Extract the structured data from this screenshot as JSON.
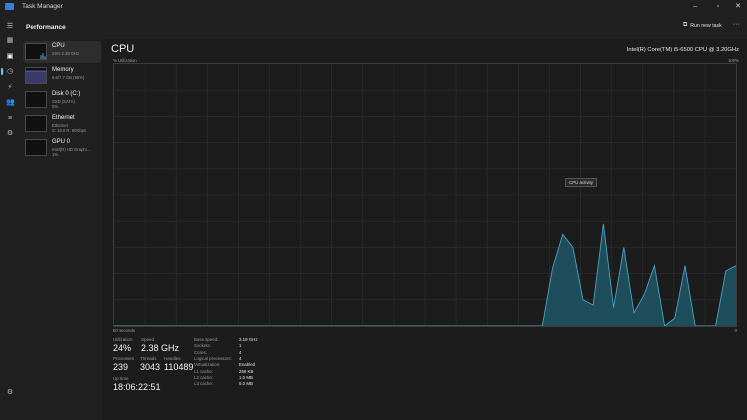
{
  "app": {
    "title": "Task Manager",
    "page_heading": "Performance",
    "run_new_task": "Run new task",
    "more": "···"
  },
  "sidebar": [
    {
      "name": "CPU",
      "line1": "24% 2.38 GHz",
      "line2": ""
    },
    {
      "name": "Memory",
      "line1": "5.6/7.7 GB (85%)",
      "line2": ""
    },
    {
      "name": "Disk 0 (C:)",
      "line1": "SSD (SATA)",
      "line2": "0%"
    },
    {
      "name": "Ethernet",
      "line1": "Ethernet",
      "line2": "S: 16.0 R: 80Kbps"
    },
    {
      "name": "GPU 0",
      "line1": "Intel(R) HD Graphi...",
      "line2": "1%"
    }
  ],
  "cpu": {
    "title": "CPU",
    "model": "Intel(R) Core(TM) i5-6500 CPU @ 3.20GHz",
    "util_label": "% Utilization",
    "util_max": "100%",
    "time_label": "60 seconds",
    "zero_label": "0",
    "tooltip": "CPU activity"
  },
  "stats": {
    "utilization": {
      "label": "Utilization",
      "value": "24%"
    },
    "speed": {
      "label": "Speed",
      "value": "2.38 GHz"
    },
    "processes": {
      "label": "Processes",
      "value": "239"
    },
    "threads": {
      "label": "Threads",
      "value": "3043"
    },
    "handles": {
      "label": "Handles",
      "value": "110489"
    },
    "uptime": {
      "label": "Up time",
      "value": "18:06:22:51"
    }
  },
  "specs": [
    {
      "k": "Base speed:",
      "v": "3.19 GHz"
    },
    {
      "k": "Sockets:",
      "v": "1"
    },
    {
      "k": "Cores:",
      "v": "4"
    },
    {
      "k": "Logical processors:",
      "v": "4"
    },
    {
      "k": "Virtualization:",
      "v": "Enabled"
    },
    {
      "k": "L1 cache:",
      "v": "256 KB"
    },
    {
      "k": "L2 cache:",
      "v": "1.0 MB"
    },
    {
      "k": "L3 cache:",
      "v": "6.0 MB"
    }
  ],
  "colors": {
    "accent": "#60cdff",
    "graph_fill": "#1e4d5c",
    "graph_line": "#4aa3c2",
    "grid": "#2f2f2f"
  },
  "cpu_history_percent": [
    0,
    0,
    0,
    0,
    0,
    0,
    0,
    0,
    0,
    0,
    0,
    0,
    0,
    0,
    0,
    0,
    0,
    0,
    0,
    0,
    0,
    0,
    0,
    0,
    0,
    0,
    0,
    0,
    0,
    0,
    0,
    0,
    0,
    0,
    0,
    0,
    0,
    0,
    0,
    0,
    0,
    0,
    0,
    22,
    35,
    30,
    10,
    8,
    39,
    7,
    30,
    5,
    12,
    23,
    0,
    3,
    23,
    0,
    0,
    0,
    21,
    23
  ]
}
